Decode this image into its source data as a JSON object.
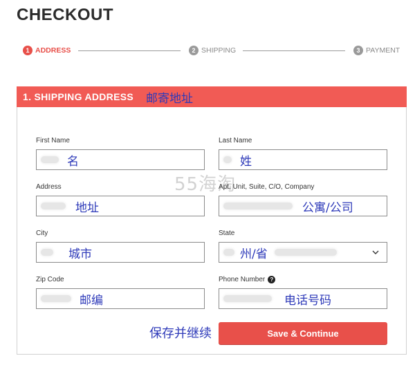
{
  "page_title": "CHECKOUT",
  "steps": [
    {
      "num": "1",
      "label": "ADDRESS",
      "state": "active"
    },
    {
      "num": "2",
      "label": "SHIPPING",
      "state": "inactive"
    },
    {
      "num": "3",
      "label": "PAYMENT",
      "state": "inactive"
    }
  ],
  "section": {
    "title": "1. SHIPPING ADDRESS",
    "title_annotation": "邮寄地址"
  },
  "watermark": "55海淘",
  "fields": {
    "first_name": {
      "label": "First Name",
      "value": "名"
    },
    "last_name": {
      "label": "Last Name",
      "value": "姓"
    },
    "address": {
      "label": "Address",
      "value": "地址"
    },
    "apt": {
      "label": "Apt, Unit, Suite, C/O, Company",
      "value": "公寓/公司"
    },
    "city": {
      "label": "City",
      "value": "城市"
    },
    "state": {
      "label": "State",
      "value": "州/省"
    },
    "zip": {
      "label": "Zip Code",
      "value": "邮编"
    },
    "phone": {
      "label": "Phone Number",
      "value": "电话号码",
      "help_icon": "?"
    }
  },
  "actions": {
    "save_annotation": "保存并继续",
    "save_label": "Save & Continue"
  },
  "colors": {
    "accent": "#e8504a",
    "annotation": "#2e3ab9",
    "inactive": "#9a9a9a"
  }
}
